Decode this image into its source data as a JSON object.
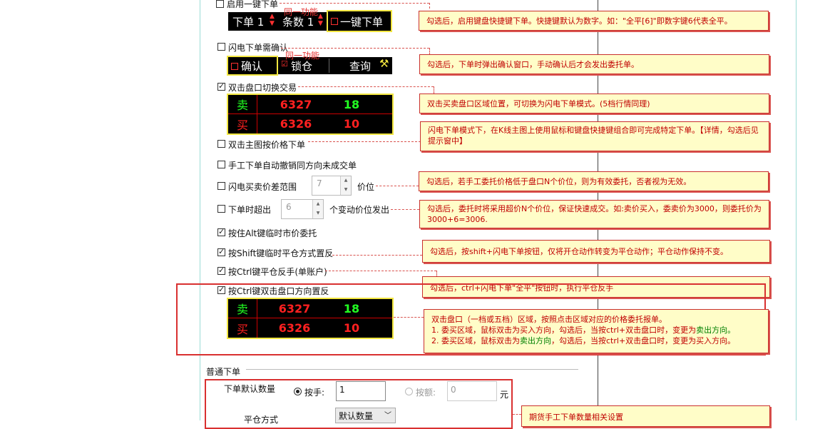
{
  "options": {
    "enable_hotkey_order": "启用一键下单",
    "flash_confirm": "闪电下单需确认",
    "dblclick_switch": "双击盘口切换交易",
    "main_chart_price": "双击主图按价格下单",
    "auto_cancel": "手工下单自动撤销同方向未成交单",
    "flash_spread": "闪电买卖价差范围",
    "flash_spread_unit": "价位",
    "flash_spread_value": "7",
    "over_price": "下单时超出",
    "over_price_unit": "个变动价位发出",
    "over_price_value": "6",
    "alt_market": "按住Alt键临时市价委托",
    "shift_reverse": "按Shift键临时平仓方式置反",
    "ctrl_reverse": "按Ctrl键平仓反手(单账户)",
    "ctrl_dblclick": "按Ctrl键双击盘口方向置反"
  },
  "hotkey_bar": {
    "qty_label": "下单 1",
    "count_label": "条数 1",
    "one_key": "一键下单",
    "same_func": "同一功能"
  },
  "confirm_bar": {
    "confirm": "确认",
    "lock": "锁仓",
    "query": "查询",
    "same_func": "同一功能"
  },
  "quote1": {
    "sell": "卖",
    "sell_price": "6327",
    "sell_qty": "18",
    "buy": "买",
    "buy_price": "6326",
    "buy_qty": "10"
  },
  "quote2": {
    "sell": "卖",
    "sell_price": "6327",
    "sell_qty": "18",
    "buy": "买",
    "buy_price": "6326",
    "buy_qty": "10"
  },
  "notes": {
    "n1": "勾选后，启用键盘快捷键下单。快捷键默认为数字。如：\"全平[6]\"即数字键6代表全平。",
    "n2": "勾选后，下单时弹出确认窗口，手动确认后才会发出委托单。",
    "n3": "双击买卖盘口区域位置，可切换为闪电下单模式。(5档行情同理)",
    "n4": "闪电下单模式下，在K线主图上使用鼠标和键盘快捷键组合即可完成特定下单。【详情，勾选后见提示窗中】",
    "n5": "勾选后，若手工委托价格低于盘口N个价位，则为有效委托，否者视为无效。",
    "n6": "勾选后，委托时将采用超价N个价位，保证快速成交。如:卖价买入，委卖价为3000，则委托价为3000+6=3006.",
    "n7": "勾选后，按shift+闪电下单按钮，仅将开仓动作转变为平仓动作；平仓动作保持不变。",
    "n8": "勾选后，ctrl+闪电下单\"全平\"按钮时，执行平仓反手",
    "n9_title": "双击盘口（一档或五档）区域，按照点击区域对应的价格委托报单。",
    "n9_l1a": "1. 委买区域，鼠标双击为买入方向，勾选后，当按ctrl+双击盘口时，变更为",
    "n9_l1b": "卖出方向。",
    "n9_l2a": "2. 委买区域，鼠标双击为",
    "n9_l2b": "卖出方向",
    "n9_l2c": "，勾选后，当按ctrl+双击盘口时，变更为买入方向。",
    "n10": "期货手工下单数量相关设置"
  },
  "normal": {
    "section": "普通下单",
    "default_qty": "下单默认数量",
    "by_hand": "按手:",
    "hand_value": "1",
    "by_amount": "按额:",
    "amount_value": "0",
    "yuan": "元",
    "close_mode": "平仓方式",
    "default_select": "默认数量"
  },
  "colors": {
    "accent_red": "#d9534f",
    "note_bg": "#fffdc8",
    "quote_border": "#f2e640"
  }
}
